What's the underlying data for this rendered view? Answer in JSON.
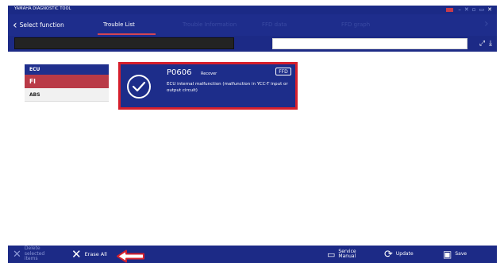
{
  "window": {
    "title": "YAMAHA DIAGNOSTIC TOOL"
  },
  "nav": {
    "back_label": "Select function",
    "tabs": [
      {
        "label": "Trouble List",
        "active": true
      },
      {
        "label": "Trouble Information",
        "active": false
      },
      {
        "label": "FFD data",
        "active": false
      },
      {
        "label": "FFD graph",
        "active": false
      }
    ]
  },
  "ecu_list": {
    "header": "ECU",
    "items": [
      {
        "label": "FI",
        "selected": true
      },
      {
        "label": "ABS",
        "selected": false
      }
    ]
  },
  "trouble": {
    "code": "P0606",
    "status": "Recover",
    "badge": "FFD",
    "description": "ECU internal malfunction (malfunction in YCC-T input or output circuit)"
  },
  "bottom_bar": {
    "delete_label": "Delete selected items",
    "erase_all_label": "Erase All",
    "service_manual_label": "Service Manual",
    "update_label": "Update",
    "save_label": "Save"
  },
  "colors": {
    "primary": "#1e2d8c",
    "accent_red": "#d61f2c",
    "selected_red": "#b93a47"
  }
}
